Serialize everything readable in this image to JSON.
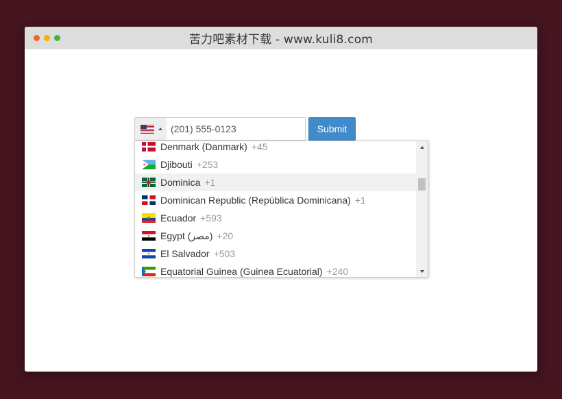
{
  "window": {
    "title": "苦力吧素材下载 - www.kuli8.com",
    "background": "#44141f",
    "traffic_lights": [
      "#f26522",
      "#f5b400",
      "#3fb83a"
    ]
  },
  "phone": {
    "selected_flag": "us-flag-icon",
    "value": "",
    "placeholder": "(201) 555-0123"
  },
  "submit": {
    "label": "Submit",
    "color": "#428bca"
  },
  "countries": [
    {
      "name": "Denmark (Danmark)",
      "dial": "+45"
    },
    {
      "name": "Djibouti",
      "dial": "+253"
    },
    {
      "name": "Dominica",
      "dial": "+1"
    },
    {
      "name": "Dominican Republic (República Dominicana)",
      "dial": "+1"
    },
    {
      "name": "Ecuador",
      "dial": "+593"
    },
    {
      "name": "Egypt (‫مصر‬‎)",
      "dial": "+20"
    },
    {
      "name": "El Salvador",
      "dial": "+503"
    },
    {
      "name": "Equatorial Guinea (Guinea Ecuatorial)",
      "dial": "+240"
    }
  ],
  "highlighted_country": "Dominica"
}
